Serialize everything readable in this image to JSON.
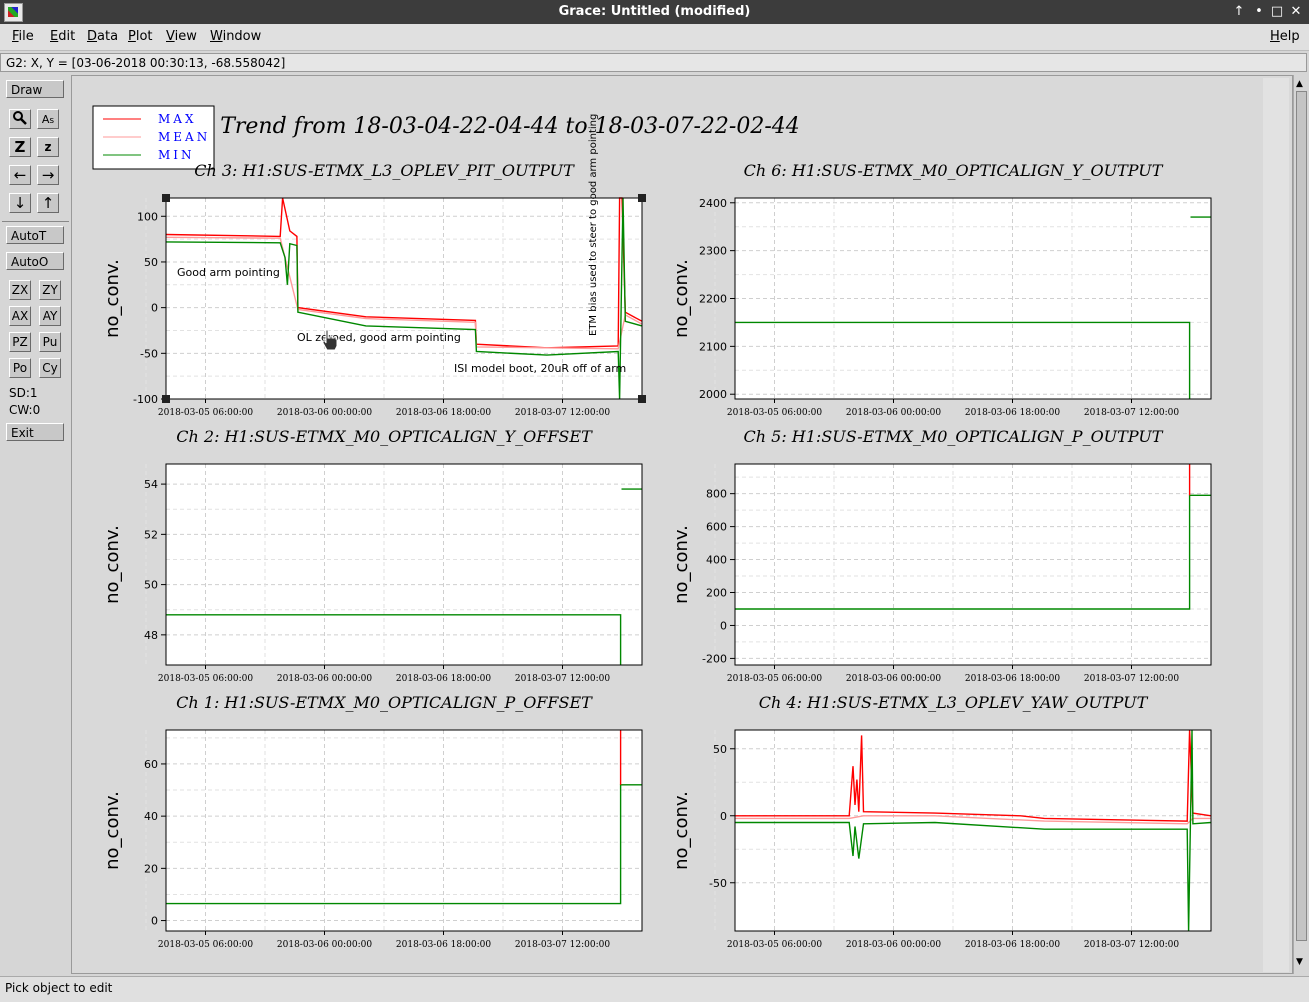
{
  "window": {
    "title": "Grace: Untitled (modified)",
    "controls": [
      "↑",
      "•",
      "□",
      "✕"
    ]
  },
  "menubar": {
    "items": [
      "File",
      "Edit",
      "Data",
      "Plot",
      "View",
      "Window"
    ],
    "help": "Help"
  },
  "locator": {
    "text": "G2: X, Y = [03-06-2018 00:30:13, -68.558042]"
  },
  "toolbox": {
    "draw": "Draw",
    "icon_rows": [
      [
        "zoom-icon",
        "text-icon"
      ],
      [
        "zoom-z-icon",
        "z-icon"
      ],
      [
        "arrow-left-icon",
        "arrow-right-icon"
      ],
      [
        "arrow-down-icon",
        "arrow-up-icon"
      ]
    ],
    "autot": "AutoT",
    "autoo": "AutoO",
    "button_grid": [
      [
        "ZX",
        "ZY"
      ],
      [
        "AX",
        "AY"
      ],
      [
        "PZ",
        "Pu"
      ],
      [
        "Po",
        "Cy"
      ]
    ],
    "sd": "SD:1",
    "cw": "CW:0",
    "exit": "Exit"
  },
  "status": {
    "text": "Pick object to edit"
  },
  "legend": {
    "items": [
      {
        "label": "MAX",
        "color": "#ff0000"
      },
      {
        "label": "MEAN",
        "color": "#ff9a9a"
      },
      {
        "label": "MIN",
        "color": "#008800"
      }
    ]
  },
  "main_title": "Trend from 18-03-04-22-04-44 to 18-03-07-22-02-44",
  "chart_data": [
    {
      "id": "ch3",
      "type": "line",
      "title": "Ch 3: H1:SUS-ETMX_L3_OPLEV_PIT_OUTPUT",
      "ylabel": "no_conv.",
      "ylim": [
        -100,
        120
      ],
      "yticks": [
        "100",
        "50",
        "0",
        "-50",
        "-100"
      ],
      "ytick_values": [
        100,
        50,
        0,
        -50,
        -100
      ],
      "xticks": [
        "2018-03-05 06:00:00",
        "2018-03-06 00:00:00",
        "2018-03-06 18:00:00",
        "2018-03-07 12:00:00"
      ],
      "annotations": [
        "Good arm pointing",
        "OL zeroed, good arm pointing",
        "ISI model boot, 20uR off of arm",
        "ETM bias used to steer to good arm pointing"
      ],
      "series": [
        {
          "name": "MAX",
          "color": "#ff0000",
          "points": [
            [
              0,
              80
            ],
            [
              0.24,
              78
            ],
            [
              0.245,
              120
            ],
            [
              0.26,
              84
            ],
            [
              0.275,
              78
            ],
            [
              0.277,
              0
            ],
            [
              0.42,
              -10
            ],
            [
              0.65,
              -14
            ],
            [
              0.652,
              -40
            ],
            [
              0.8,
              -44
            ],
            [
              0.95,
              -42
            ],
            [
              0.953,
              120
            ],
            [
              0.958,
              120
            ],
            [
              0.965,
              -5
            ],
            [
              1,
              -15
            ]
          ]
        },
        {
          "name": "MEAN",
          "color": "#ff9a9a",
          "points": [
            [
              0,
              77
            ],
            [
              0.24,
              76
            ],
            [
              0.277,
              -2
            ],
            [
              0.42,
              -12
            ],
            [
              0.65,
              -16
            ],
            [
              0.652,
              -43
            ],
            [
              0.95,
              -45
            ],
            [
              0.965,
              -8
            ],
            [
              1,
              -18
            ]
          ]
        },
        {
          "name": "MIN",
          "color": "#008800",
          "points": [
            [
              0,
              72
            ],
            [
              0.24,
              71
            ],
            [
              0.25,
              55
            ],
            [
              0.255,
              25
            ],
            [
              0.26,
              70
            ],
            [
              0.275,
              68
            ],
            [
              0.277,
              -5
            ],
            [
              0.42,
              -20
            ],
            [
              0.65,
              -24
            ],
            [
              0.652,
              -48
            ],
            [
              0.8,
              -52
            ],
            [
              0.95,
              -48
            ],
            [
              0.953,
              -100
            ],
            [
              0.96,
              120
            ],
            [
              0.965,
              -15
            ],
            [
              1,
              -20
            ]
          ]
        }
      ]
    },
    {
      "id": "ch6",
      "type": "line",
      "title": "Ch 6: H1:SUS-ETMX_M0_OPTICALIGN_Y_OUTPUT",
      "ylabel": "no_conv.",
      "ylim": [
        1990,
        2410
      ],
      "yticks": [
        "2400",
        "2300",
        "2200",
        "2100",
        "2000"
      ],
      "ytick_values": [
        2400,
        2300,
        2200,
        2100,
        2000
      ],
      "xticks": [
        "2018-03-05 06:00:00",
        "2018-03-06 00:00:00",
        "2018-03-06 18:00:00",
        "2018-03-07 12:00:00"
      ],
      "series": [
        {
          "name": "MIN",
          "color": "#008800",
          "points": [
            [
              0,
              2150
            ],
            [
              0.955,
              2150
            ],
            [
              0.955,
              1990
            ]
          ]
        },
        {
          "name": "MAX",
          "color": "#008800",
          "points": [
            [
              0.957,
              2370
            ],
            [
              1,
              2370
            ]
          ]
        }
      ]
    },
    {
      "id": "ch2",
      "type": "line",
      "title": "Ch 2: H1:SUS-ETMX_M0_OPTICALIGN_Y_OFFSET",
      "ylabel": "no_conv.",
      "ylim": [
        46.8,
        54.8
      ],
      "yticks": [
        "54",
        "52",
        "50",
        "48"
      ],
      "ytick_values": [
        54,
        52,
        50,
        48
      ],
      "xticks": [
        "2018-03-05 06:00:00",
        "2018-03-06 00:00:00",
        "2018-03-06 18:00:00",
        "2018-03-07 12:00:00"
      ],
      "series": [
        {
          "name": "MIN",
          "color": "#008800",
          "points": [
            [
              0,
              48.8
            ],
            [
              0.955,
              48.8
            ],
            [
              0.955,
              46.8
            ]
          ]
        },
        {
          "name": "MAX",
          "color": "#008800",
          "points": [
            [
              0.957,
              53.8
            ],
            [
              1,
              53.8
            ]
          ]
        }
      ]
    },
    {
      "id": "ch5",
      "type": "line",
      "title": "Ch 5: H1:SUS-ETMX_M0_OPTICALIGN_P_OUTPUT",
      "ylabel": "no_conv.",
      "ylim": [
        -240,
        980
      ],
      "yticks": [
        "800",
        "600",
        "400",
        "200",
        "0",
        "-200"
      ],
      "ytick_values": [
        800,
        600,
        400,
        200,
        0,
        -200
      ],
      "xticks": [
        "2018-03-05 06:00:00",
        "2018-03-06 00:00:00",
        "2018-03-06 18:00:00",
        "2018-03-07 12:00:00"
      ],
      "series": [
        {
          "name": "MIN",
          "color": "#008800",
          "points": [
            [
              0,
              100
            ],
            [
              0.955,
              100
            ],
            [
              0.955,
              790
            ],
            [
              1,
              790
            ]
          ]
        },
        {
          "name": "MAX",
          "color": "#ff0000",
          "points": [
            [
              0.955,
              980
            ],
            [
              0.955,
              790
            ]
          ]
        }
      ]
    },
    {
      "id": "ch1",
      "type": "line",
      "title": "Ch 1: H1:SUS-ETMX_M0_OPTICALIGN_P_OFFSET",
      "ylabel": "no_conv.",
      "ylim": [
        -4,
        73
      ],
      "yticks": [
        "60",
        "40",
        "20",
        "0"
      ],
      "ytick_values": [
        60,
        40,
        20,
        0
      ],
      "xticks": [
        "2018-03-05 06:00:00",
        "2018-03-06 00:00:00",
        "2018-03-06 18:00:00",
        "2018-03-07 12:00:00"
      ],
      "series": [
        {
          "name": "MIN",
          "color": "#008800",
          "points": [
            [
              0,
              6.5
            ],
            [
              0.955,
              6.5
            ],
            [
              0.955,
              52
            ],
            [
              1,
              52
            ]
          ]
        },
        {
          "name": "MAX",
          "color": "#ff0000",
          "points": [
            [
              0.955,
              73
            ],
            [
              0.955,
              52
            ]
          ]
        }
      ]
    },
    {
      "id": "ch4",
      "type": "line",
      "title": "Ch 4: H1:SUS-ETMX_L3_OPLEV_YAW_OUTPUT",
      "ylabel": "no_conv.",
      "ylim": [
        -86,
        64
      ],
      "yticks": [
        "50",
        "0",
        "-50"
      ],
      "ytick_values": [
        50,
        0,
        -50
      ],
      "xticks": [
        "2018-03-05 06:00:00",
        "2018-03-06 00:00:00",
        "2018-03-06 18:00:00",
        "2018-03-07 12:00:00"
      ],
      "series": [
        {
          "name": "MAX",
          "color": "#ff0000",
          "points": [
            [
              0,
              0
            ],
            [
              0.24,
              0
            ],
            [
              0.248,
              37
            ],
            [
              0.252,
              8
            ],
            [
              0.256,
              27
            ],
            [
              0.26,
              3
            ],
            [
              0.266,
              60
            ],
            [
              0.27,
              3
            ],
            [
              0.42,
              2
            ],
            [
              0.6,
              0
            ],
            [
              0.65,
              -2
            ],
            [
              0.95,
              -4
            ],
            [
              0.955,
              64
            ],
            [
              0.962,
              2
            ],
            [
              1,
              0
            ]
          ]
        },
        {
          "name": "MEAN",
          "color": "#ff9a9a",
          "points": [
            [
              0,
              -2
            ],
            [
              0.24,
              -2
            ],
            [
              0.27,
              0
            ],
            [
              0.42,
              0
            ],
            [
              0.65,
              -4
            ],
            [
              0.95,
              -6
            ],
            [
              0.962,
              -2
            ],
            [
              1,
              -2
            ]
          ]
        },
        {
          "name": "MIN",
          "color": "#008800",
          "points": [
            [
              0,
              -5
            ],
            [
              0.24,
              -5
            ],
            [
              0.248,
              -30
            ],
            [
              0.252,
              -8
            ],
            [
              0.26,
              -32
            ],
            [
              0.27,
              -6
            ],
            [
              0.42,
              -5
            ],
            [
              0.65,
              -10
            ],
            [
              0.95,
              -10
            ],
            [
              0.953,
              -86
            ],
            [
              0.96,
              64
            ],
            [
              0.962,
              -6
            ],
            [
              1,
              -5
            ]
          ]
        }
      ]
    }
  ]
}
